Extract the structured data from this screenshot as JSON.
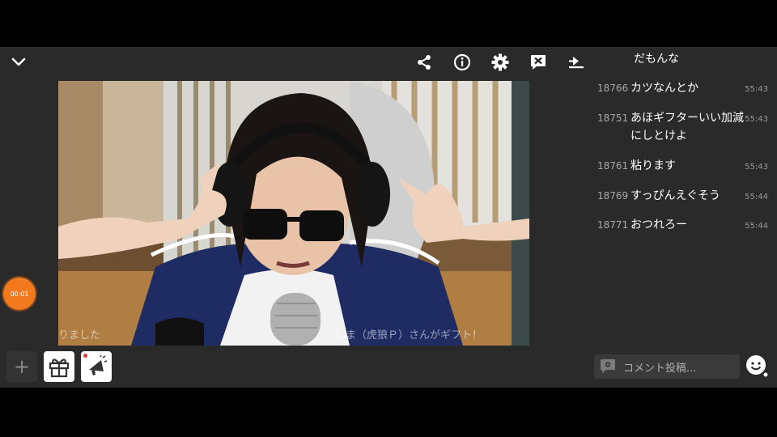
{
  "toolbar": {
    "icons": [
      "chevron-down-icon",
      "share-icon",
      "info-icon",
      "settings-icon",
      "mute-comments-icon",
      "collapse-panel-icon"
    ]
  },
  "video": {
    "overlay_left": "りました",
    "overlay_right": "しま（虎狼Ｐ）さんがギフト！"
  },
  "timer": {
    "label": "00:01",
    "color": "#f27a1c"
  },
  "comments": [
    {
      "num": "",
      "text": "だもんな",
      "time": ""
    },
    {
      "num": "18766",
      "text": "カツなんとか",
      "time": "55:43"
    },
    {
      "num": "18751",
      "text": "あほギフターいい加減にしとけよ",
      "time": "55:43"
    },
    {
      "num": "18761",
      "text": "粘ります",
      "time": "55:43"
    },
    {
      "num": "18769",
      "text": "すっぴんえぐそう",
      "time": "55:44"
    },
    {
      "num": "18771",
      "text": "おつれろー",
      "time": "55:44"
    }
  ],
  "comment_input": {
    "placeholder": "コメント投稿..."
  },
  "bottom": {
    "plus_label": "+"
  }
}
